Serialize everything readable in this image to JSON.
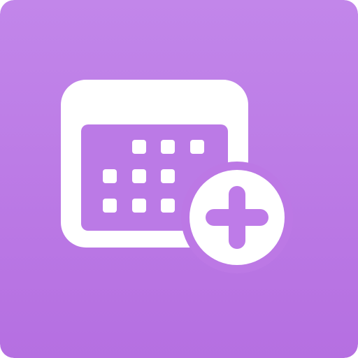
{
  "icon": {
    "name": "add-calendar-event",
    "background_color_top": "#C286EA",
    "background_color_bottom": "#B56FE1",
    "glyph_color": "#FFFFFF",
    "inner_panel_color": "#BB7AE6",
    "plus_color": "#BE7BE8",
    "calendar_grid": {
      "rows": 3,
      "visible_dots_per_row": [
        3,
        3,
        3
      ]
    }
  }
}
